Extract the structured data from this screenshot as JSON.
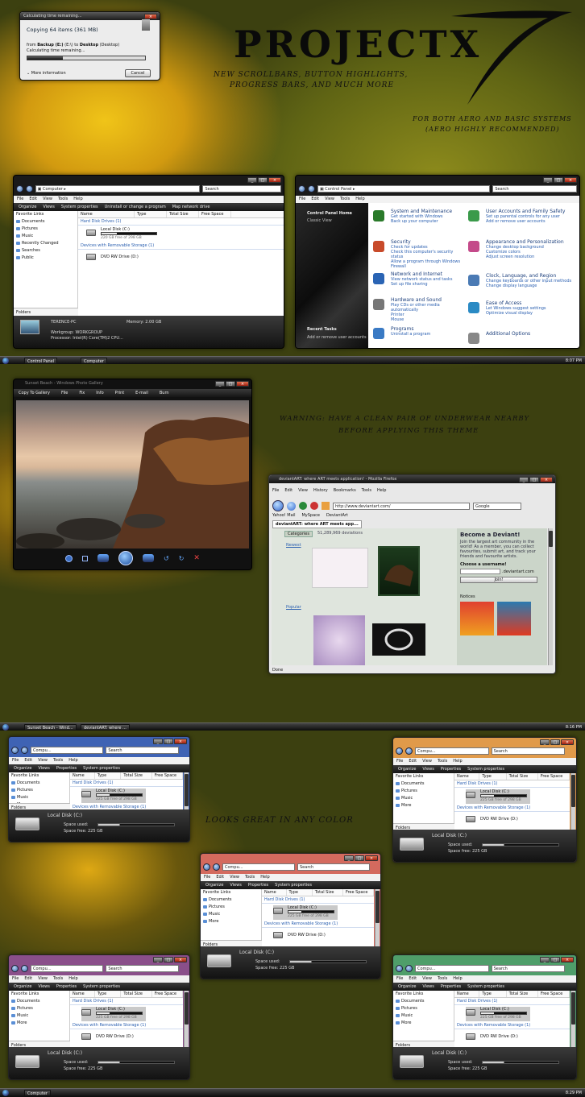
{
  "copy_dialog": {
    "title": "Calculating time remaining...",
    "heading": "Copying 64 items (361 MB)",
    "from_label": "from",
    "from_src": "Backup (E:)",
    "path_mid": "(E:\\) to",
    "to_dst": "Desktop",
    "to_suffix": "(Desktop)",
    "status": "Calculating time remaining...",
    "more_info": "More information",
    "cancel": "Cancel",
    "progress": 0.3
  },
  "banner": {
    "title": "PROJECTX",
    "tag1": "New Scrollbars, button highlights,",
    "tag2": "progress bars, and much more",
    "aero1": "For both aero and basic systems",
    "aero2": "(aero highly recommended)",
    "warn1": "Warning: have a clean pair of underwear nearby",
    "warn2": "before applying this theme",
    "color": "Looks Great In Any Color"
  },
  "explorer": {
    "path": "Computer",
    "search": "Search",
    "menu": [
      "File",
      "Edit",
      "View",
      "Tools",
      "Help"
    ],
    "toolbar": [
      "Organize",
      "Views",
      "System properties",
      "Uninstall or change a program",
      "Map network drive"
    ],
    "fav_header": "Favorite Links",
    "favs": [
      "Documents",
      "Pictures",
      "Music",
      "Recently Changed",
      "Searches",
      "Public"
    ],
    "folders": "Folders",
    "cols": [
      "Name",
      "Type",
      "Total Size",
      "Free Space"
    ],
    "grp_hdd": "Hard Disk Drives (1)",
    "disk": "Local Disk (C:)",
    "disk_free": "220 GB free of 298 GB",
    "grp_rem": "Devices with Removable Storage (1)",
    "dvd": "DVD RW Drive (D:)",
    "pc": "TERENCE-PC",
    "workgroup": "Workgroup: WORKGROUP",
    "memory": "Memory: 2.00 GB",
    "proc": "Processor: Intel(R) Core(TM)2 CPU..."
  },
  "cpanel": {
    "path": "Control Panel",
    "search": "Search",
    "menu": [
      "File",
      "Edit",
      "View",
      "Tools",
      "Help"
    ],
    "home": "Control Panel Home",
    "classic": "Classic View",
    "recent": "Recent Tasks",
    "recent_item": "Add or remove user accounts",
    "items": [
      {
        "t": "System and Maintenance",
        "d": "Get started with Windows\nBack up your computer"
      },
      {
        "t": "Security",
        "d": "Check for updates\nCheck this computer's security status\nAllow a program through Windows Firewall"
      },
      {
        "t": "Network and Internet",
        "d": "View network status and tasks\nSet up file sharing"
      },
      {
        "t": "Hardware and Sound",
        "d": "Play CDs or other media automatically\nPrinter\nMouse"
      },
      {
        "t": "Programs",
        "d": "Uninstall a program"
      },
      {
        "t": "User Accounts and Family Safety",
        "d": "Set up parental controls for any user\nAdd or remove user accounts"
      },
      {
        "t": "Appearance and Personalization",
        "d": "Change desktop background\nCustomize colors\nAdjust screen resolution"
      },
      {
        "t": "Clock, Language, and Region",
        "d": "Change keyboards or other input methods\nChange display language"
      },
      {
        "t": "Ease of Access",
        "d": "Let Windows suggest settings\nOptimize visual display"
      },
      {
        "t": "Additional Options",
        "d": ""
      }
    ]
  },
  "taskbar1": {
    "items": [
      "Control Panel",
      "Computer"
    ],
    "clock": "8:07 PM"
  },
  "gallery": {
    "title": "Sunset Beach - Windows Photo Gallery",
    "toolbar": [
      "Copy To Gallery",
      "File",
      "Fix",
      "Info",
      "Print",
      "E-mail",
      "Burn"
    ]
  },
  "firefox": {
    "title": "deviantART: where ART meets application! - Mozilla Firefox",
    "menu": [
      "File",
      "Edit",
      "View",
      "History",
      "Bookmarks",
      "Tools",
      "Help"
    ],
    "url": "http://www.deviantart.com/",
    "search": "Google",
    "bookmarks": [
      "Yahoo! Mail",
      "MySpace",
      "DeviantArt"
    ],
    "tab": "deviantART: where ART meets app...",
    "categories": "Categories",
    "deviations": "51,289,969 deviations",
    "newest": "Newest",
    "popular": "Popular",
    "become": "Become a Deviant!",
    "blurb": "Join the largest art community in the world! As a member, you can collect favourites, submit art, and track your friends and favourite artists.",
    "choose": "Choose a username!",
    "domain": ".deviantart.com",
    "join": "Join!",
    "notices": "Notices",
    "status": "Done"
  },
  "taskbar2": {
    "items": [
      "Sunset Beach - Wind...",
      "deviantART: where ..."
    ],
    "clock": "8:16 PM"
  },
  "mini": {
    "path": "Compu...",
    "search": "Search",
    "menu": [
      "File",
      "Edit",
      "View",
      "Tools",
      "Help"
    ],
    "toolbar": [
      "Organize",
      "Views",
      "Properties",
      "System properties"
    ],
    "fav_header": "Favorite Links",
    "favs": [
      "Documents",
      "Pictures",
      "Music",
      "More"
    ],
    "folders": "Folders",
    "cols": [
      "Name",
      "Type",
      "Total Size",
      "Free Space"
    ],
    "grp_hdd": "Hard Disk Drives (1)",
    "disk": "Local Disk (C:)",
    "disk_free": "225 GB free of 298 GB",
    "grp_rem": "Devices with Removable Storage (1)",
    "dvd": "DVD RW Drive (D:)",
    "det_name": "Local Disk (C:)",
    "space_used": "Space used:",
    "space_free": "Space free: 225 GB"
  },
  "taskbar3": {
    "items": [
      "Computer"
    ],
    "clock": "8:29 PM"
  },
  "colors": {
    "blue": "#3f63b4",
    "orange": "#e09a4a",
    "red": "#d46a5e",
    "purple": "#8a4f8a",
    "green": "#4f9e6a"
  }
}
